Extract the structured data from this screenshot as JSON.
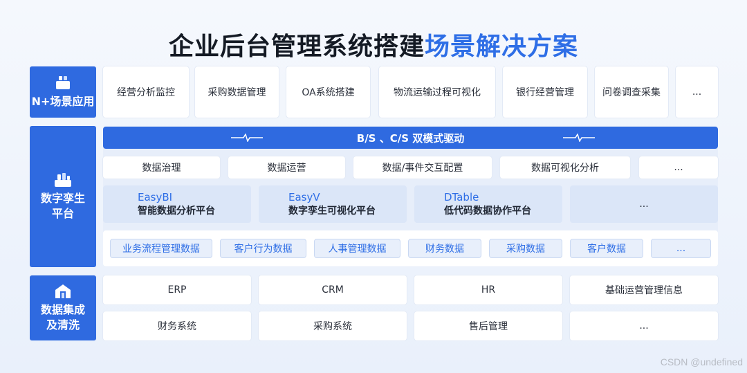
{
  "title": {
    "dark": "企业后台管理系统搭建",
    "blue": "场景解决方案"
  },
  "rows": {
    "apps": {
      "label": "N+场景应用",
      "icon": "app-blocks-icon",
      "items": [
        "经营分析监控",
        "采购数据管理",
        "OA系统搭建",
        "物流运输过程可视化",
        "银行经营管理",
        "问卷调查采集",
        "..."
      ]
    },
    "twin": {
      "label_line1": "数字孪生",
      "label_line2": "平台",
      "icon": "platform-blocks-icon",
      "bar": "B/S 、C/S 双模式驱动",
      "functions": [
        "数据治理",
        "数据运营",
        "数据/事件交互配置",
        "数据可视化分析",
        "..."
      ],
      "products": [
        {
          "name": "EasyBI",
          "desc": "智能数据分析平台"
        },
        {
          "name": "EasyV",
          "desc": "数字孪生可视化平台"
        },
        {
          "name": "DTable",
          "desc": "低代码数据协作平台"
        }
      ],
      "products_more": "...",
      "tags": [
        "业务流程管理数据",
        "客户行为数据",
        "人事管理数据",
        "财务数据",
        "采购数据",
        "客户数据",
        "..."
      ]
    },
    "integration": {
      "label_line1": "数据集成",
      "label_line2": "及清洗",
      "icon": "data-house-icon",
      "row1": [
        "ERP",
        "CRM",
        "HR",
        "基础运营管理信息"
      ],
      "row2": [
        "财务系统",
        "采购系统",
        "售后管理",
        "..."
      ]
    }
  },
  "watermark": "CSDN @undefined",
  "colors": {
    "primary": "#2f6ae0",
    "title_blue": "#2e6ee6"
  }
}
